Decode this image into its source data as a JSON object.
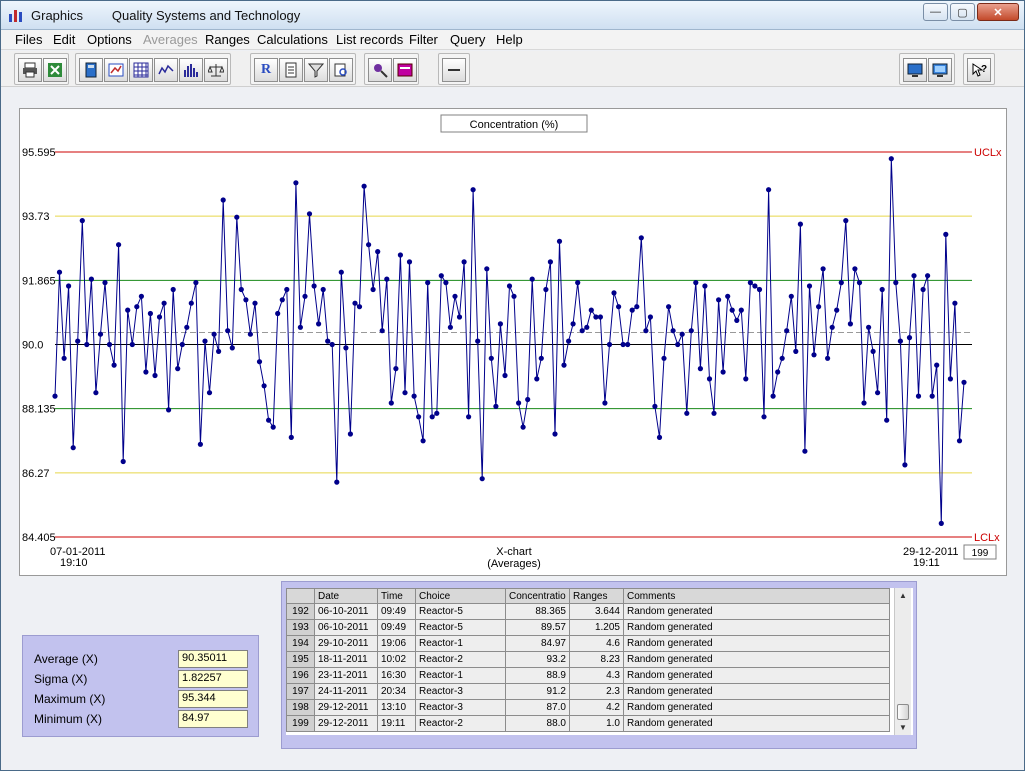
{
  "window": {
    "title": "Graphics        Quality Systems and Technology"
  },
  "menu": [
    "Files",
    "Edit",
    "Options",
    "Averages",
    "Ranges",
    "Calculations",
    "List records",
    "Filter",
    "Query",
    "Help"
  ],
  "menu_disabled": [
    "Averages"
  ],
  "toolbar": {
    "icons": [
      "printer-icon",
      "excel-icon",
      "calculator-icon",
      "chart-window-icon",
      "grid-icon",
      "line-chart-icon",
      "histogram-icon",
      "balance-icon",
      "r-icon",
      "document-icon",
      "filter-icon",
      "query-icon",
      "wand-icon",
      "form-icon",
      "minus-icon",
      "monitor-icon",
      "monitor-full-icon",
      "help-icon"
    ]
  },
  "chart": {
    "title": "Concentration (%)",
    "x_title": "X-chart",
    "x_subtitle": "(Averages)",
    "x_start_date": "07-01-2011",
    "x_start_time": "19:10",
    "x_end_date": "29-12-2011",
    "x_end_time": "19:11",
    "record_count": "199",
    "ucl_label": "UCLx",
    "lcl_label": "LCLx",
    "tick_labels": [
      "95.595",
      "93.73",
      "91.865",
      "90.0",
      "88.135",
      "86.27",
      "84.405"
    ],
    "colors": {
      "line": "#00008b",
      "ucl": "#cc0000",
      "two_sigma": "#e6d64a",
      "one_sigma": "#1a8a1a",
      "center": "#000000",
      "average": "#999999"
    }
  },
  "chart_data": {
    "type": "line",
    "title": "Concentration (%)",
    "xlabel": "X-chart (Averages)",
    "ylabel": "",
    "ylim": [
      84.405,
      95.595
    ],
    "reference_lines": {
      "UCLx": 95.595,
      "plus_2_sigma": 93.73,
      "plus_1_sigma": 91.865,
      "center": 90.0,
      "minus_1_sigma": 88.135,
      "minus_2_sigma": 86.27,
      "LCLx": 84.405,
      "average": 90.35011
    },
    "series": [
      {
        "values": [
          88.5,
          92.1,
          89.6,
          91.7,
          87.0,
          90.1,
          93.6,
          90.0,
          91.9,
          88.6,
          90.3,
          91.8,
          90.0,
          89.4,
          92.9,
          86.6,
          91.0,
          90.0,
          91.1,
          91.4,
          89.2,
          90.9,
          89.1,
          90.8,
          91.2,
          88.1,
          91.6,
          89.3,
          90.0,
          90.5,
          91.2,
          91.8,
          87.1,
          90.1,
          88.6,
          90.3,
          89.8,
          94.2,
          90.4,
          89.9,
          93.7,
          91.6,
          91.3,
          90.3,
          91.2,
          89.5,
          88.8,
          87.8,
          87.6,
          90.9,
          91.3,
          91.6,
          87.3,
          94.7,
          90.5,
          91.4,
          93.8,
          91.7,
          90.6,
          91.6,
          90.1,
          90.0,
          86.0,
          92.1,
          89.9,
          87.4,
          91.2,
          91.1,
          94.6,
          92.9,
          91.6,
          92.7,
          90.4,
          91.9,
          88.3,
          89.3,
          92.6,
          88.6,
          92.4,
          88.5,
          87.9,
          87.2,
          91.8,
          87.9,
          88.0,
          92.0,
          91.8,
          90.5,
          91.4,
          90.8,
          92.4,
          87.9,
          94.5,
          90.1,
          86.1,
          92.2,
          89.6,
          88.2,
          90.6,
          89.1,
          91.7,
          91.4,
          88.3,
          87.6,
          88.4,
          91.9,
          89.0,
          89.6,
          91.6,
          92.4,
          87.4,
          93.0,
          89.4,
          90.1,
          90.6,
          91.8,
          90.4,
          90.5,
          91.0,
          90.8,
          90.8,
          88.3,
          90.0,
          91.5,
          91.1,
          90.0,
          90.0,
          91.0,
          91.1,
          93.1,
          90.4,
          90.8,
          88.2,
          87.3,
          89.6,
          91.1,
          90.4,
          90.0,
          90.3,
          88.0,
          90.4,
          91.8,
          89.3,
          91.7,
          89.0,
          88.0,
          91.3,
          89.2,
          91.4,
          91.0,
          90.7,
          91.0,
          89.0,
          91.8,
          91.7,
          91.6,
          87.9,
          94.5,
          88.5,
          89.2,
          89.6,
          90.4,
          91.4,
          89.8,
          93.5,
          86.9,
          91.7,
          89.7,
          91.1,
          92.2,
          89.6,
          90.5,
          91.0,
          91.8,
          93.6,
          90.6,
          92.2,
          91.8,
          88.3,
          90.5,
          89.8,
          88.6,
          91.6,
          87.8,
          95.4,
          91.8,
          90.1,
          86.5,
          90.2,
          92.0,
          88.5,
          91.6,
          92.0,
          88.5,
          89.4,
          84.8,
          93.2,
          89.0,
          91.2,
          87.2,
          88.9
        ]
      }
    ]
  },
  "table": {
    "columns": [
      "Date",
      "Time",
      "Choice",
      "Concentratio",
      "Ranges",
      "Comments"
    ],
    "rows": [
      {
        "id": "192",
        "date": "06-10-2011",
        "time": "09:49",
        "choice": "Reactor-5",
        "conc": "88.365",
        "range": "3.644",
        "comment": "Random generated"
      },
      {
        "id": "193",
        "date": "06-10-2011",
        "time": "09:49",
        "choice": "Reactor-5",
        "conc": "89.57",
        "range": "1.205",
        "comment": "Random generated"
      },
      {
        "id": "194",
        "date": "29-10-2011",
        "time": "19:06",
        "choice": "Reactor-1",
        "conc": "84.97",
        "range": "4.6",
        "comment": "Random generated"
      },
      {
        "id": "195",
        "date": "18-11-2011",
        "time": "10:02",
        "choice": "Reactor-2",
        "conc": "93.2",
        "range": "8.23",
        "comment": "Random generated"
      },
      {
        "id": "196",
        "date": "23-11-2011",
        "time": "16:30",
        "choice": "Reactor-1",
        "conc": "88.9",
        "range": "4.3",
        "comment": "Random generated"
      },
      {
        "id": "197",
        "date": "24-11-2011",
        "time": "20:34",
        "choice": "Reactor-3",
        "conc": "91.2",
        "range": "2.3",
        "comment": "Random generated"
      },
      {
        "id": "198",
        "date": "29-12-2011",
        "time": "13:10",
        "choice": "Reactor-3",
        "conc": "87.0",
        "range": "4.2",
        "comment": "Random generated"
      },
      {
        "id": "199",
        "date": "29-12-2011",
        "time": "19:11",
        "choice": "Reactor-2",
        "conc": "88.0",
        "range": "1.0",
        "comment": "Random generated"
      }
    ]
  },
  "stats": [
    {
      "label": "Average (X)",
      "value": "90.35011"
    },
    {
      "label": "Sigma (X)",
      "value": "1.82257"
    },
    {
      "label": "Maximum (X)",
      "value": "95.344"
    },
    {
      "label": "Minimum (X)",
      "value": "84.97"
    }
  ]
}
